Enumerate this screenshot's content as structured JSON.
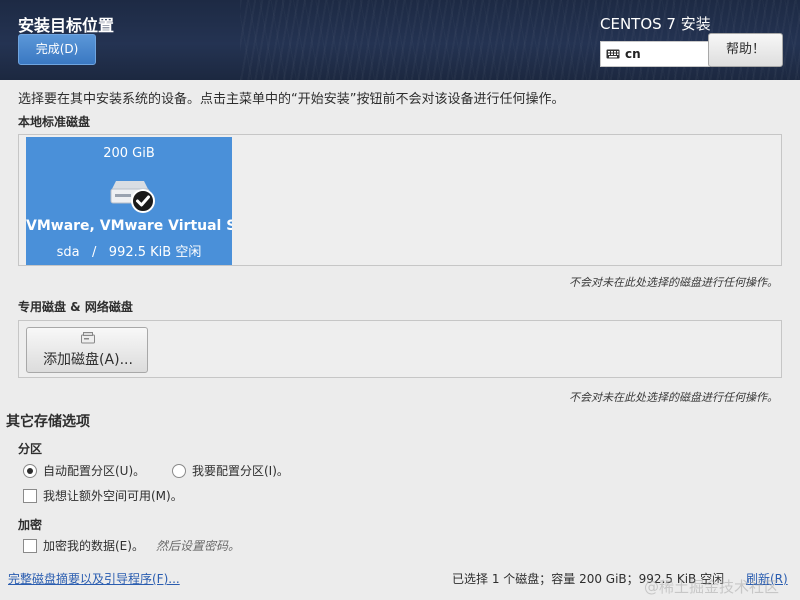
{
  "header": {
    "spoke_title": "安装目标位置",
    "done_label": "完成(D)",
    "product_title": "CENTOS 7 安装",
    "keyboard_layout": "cn",
    "help_label": "帮助！"
  },
  "intro": "选择要在其中安装系统的设备。点击主菜单中的“开始安装”按钮前不会对该设备进行任何操作。",
  "local_disks": {
    "label": "本地标准磁盘",
    "disks": [
      {
        "size": "200 GiB",
        "name": "VMware, VMware Virtual S",
        "info": "sda   /   992.5 KiB 空闲",
        "selected": true
      }
    ],
    "note": "不会对未在此处选择的磁盘进行任何操作。"
  },
  "special_disks": {
    "label": "专用磁盘 & 网络磁盘",
    "add_label": "添加磁盘(A)...",
    "note": "不会对未在此处选择的磁盘进行任何操作。"
  },
  "other_storage": {
    "title": "其它存储选项",
    "partition_label": "分区",
    "auto_partition": "自动配置分区(U)。",
    "manual_partition": "我要配置分区(I)。",
    "extra_space": "我想让额外空间可用(M)。",
    "encryption_label": "加密",
    "encrypt_data": "加密我的数据(E)。",
    "encrypt_hint": "然后设置密码。"
  },
  "footer": {
    "summary_link": "完整磁盘摘要以及引导程序(F)...",
    "status": "已选择 1 个磁盘；容量 200 GiB；992.5 KiB 空闲",
    "refresh_link": "刷新(R)",
    "watermark": "@稀土掘金技术社区"
  },
  "colors": {
    "header_bg": "#243352",
    "accent": "#4a90d9",
    "link": "#2a5db0"
  }
}
